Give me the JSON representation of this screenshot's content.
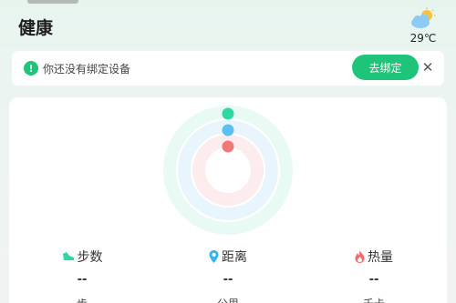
{
  "header": {
    "title": "健康"
  },
  "weather": {
    "icon": "partly-cloudy-icon",
    "temperature": "29℃"
  },
  "device_notice": {
    "icon": "exclamation-icon",
    "message": "你还没有绑定设备",
    "button_label": "去绑定",
    "close_icon": "close-icon"
  },
  "activity": {
    "rings": [
      {
        "name": "steps",
        "color": "#2ed8a3",
        "progress": 0
      },
      {
        "name": "distance",
        "color": "#5bc0f0",
        "progress": 0
      },
      {
        "name": "calories",
        "color": "#f27878",
        "progress": 0
      }
    ],
    "stats": [
      {
        "icon": "shoe-icon",
        "label": "步数",
        "value": "--",
        "unit": "步",
        "color": "#2ed8a3"
      },
      {
        "icon": "location-pin-icon",
        "label": "距离",
        "value": "--",
        "unit": "公里",
        "color": "#35b6ec"
      },
      {
        "icon": "flame-icon",
        "label": "热量",
        "value": "--",
        "unit": "千卡",
        "color": "#f06a6a"
      }
    ]
  }
}
